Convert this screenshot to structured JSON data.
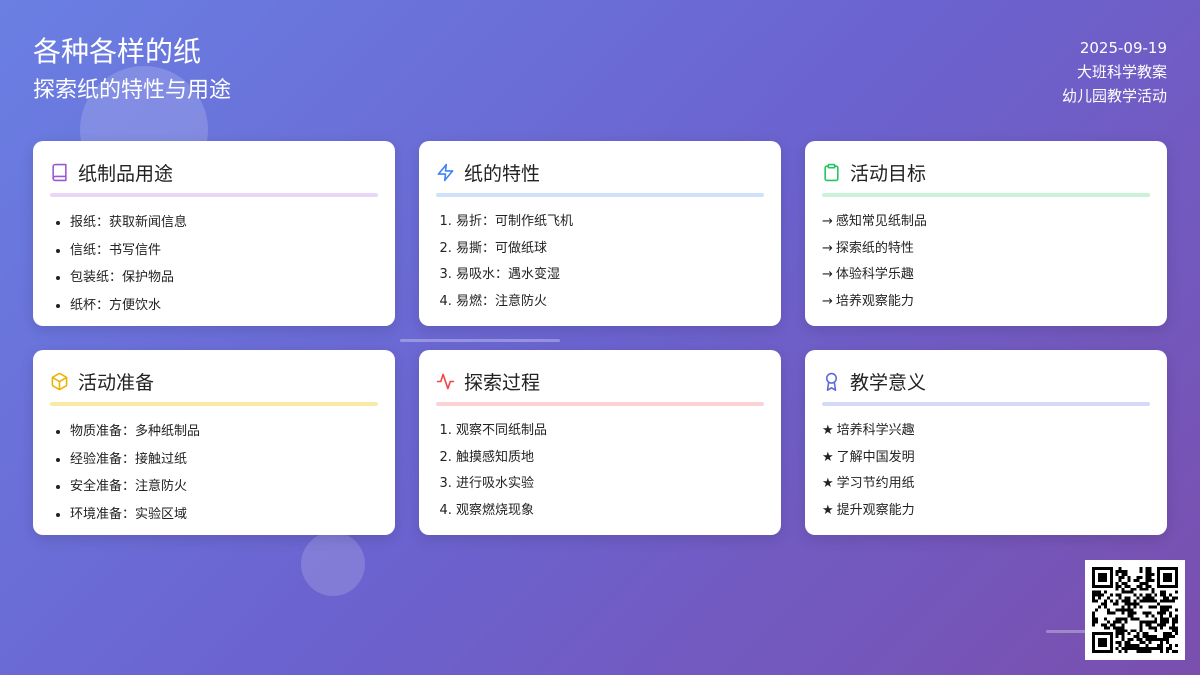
{
  "header": {
    "title": "各种各样的纸",
    "subtitle": "探索纸的特性与用途",
    "date": "2025-09-19",
    "course": "大班科学教案",
    "org": "幼儿园教学活动"
  },
  "colors": {
    "card_1_accent": "#9b59d0",
    "card_2_accent": "#3b82f6",
    "card_3_accent": "#22c55e",
    "card_4_accent": "#eab308",
    "card_5_accent": "#ef4444",
    "card_6_accent": "#5b6bd6"
  },
  "cards": [
    {
      "title": "纸制品用途",
      "icon": "book-icon",
      "items": [
        "报纸：获取新闻信息",
        "信纸：书写信件",
        "包装纸：保护物品",
        "纸杯：方便饮水"
      ]
    },
    {
      "title": "纸的特性",
      "icon": "lightning-icon",
      "items": [
        "易折：可制作纸飞机",
        "易撕：可做纸球",
        "易吸水：遇水变湿",
        "易燃：注意防火"
      ]
    },
    {
      "title": "活动目标",
      "icon": "clipboard-icon",
      "prefix": "→",
      "items": [
        "感知常见纸制品",
        "探索纸的特性",
        "体验科学乐趣",
        "培养观察能力"
      ]
    },
    {
      "title": "活动准备",
      "icon": "cube-icon",
      "items": [
        "物质准备：多种纸制品",
        "经验准备：接触过纸",
        "安全准备：注意防火",
        "环境准备：实验区域"
      ]
    },
    {
      "title": "探索过程",
      "icon": "activity-icon",
      "items": [
        "观察不同纸制品",
        "触摸感知质地",
        "进行吸水实验",
        "观察燃烧现象"
      ]
    },
    {
      "title": "教学意义",
      "icon": "award-icon",
      "prefix": "★",
      "items": [
        "培养科学兴趣",
        "了解中国发明",
        "学习节约用纸",
        "提升观察能力"
      ]
    }
  ]
}
